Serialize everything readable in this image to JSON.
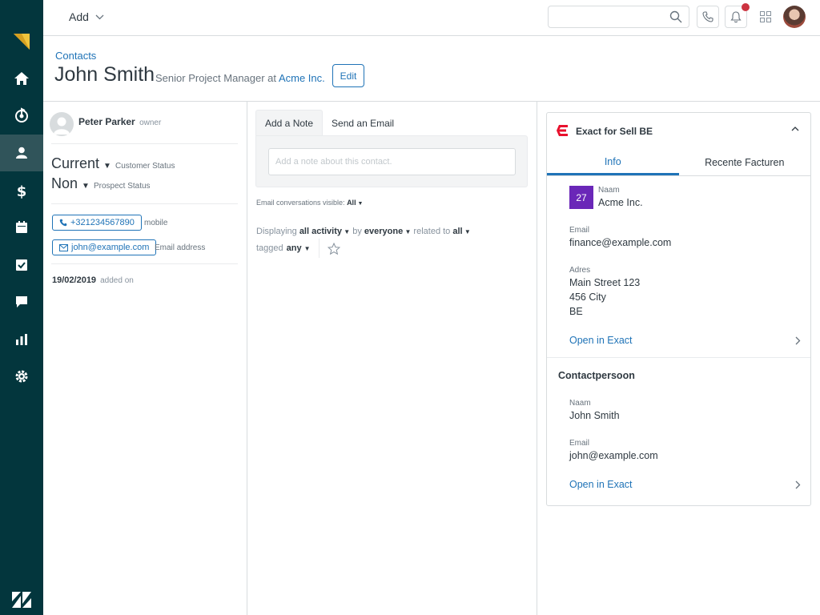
{
  "sidebar": {
    "logo": "zendesk-sell-logo",
    "items": [
      {
        "icon": "home-icon"
      },
      {
        "icon": "leads-icon"
      },
      {
        "icon": "contacts-icon",
        "active": true
      },
      {
        "icon": "deals-icon"
      },
      {
        "icon": "calendar-icon"
      },
      {
        "icon": "tasks-icon"
      },
      {
        "icon": "communication-icon"
      },
      {
        "icon": "reports-icon"
      },
      {
        "icon": "settings-icon"
      }
    ],
    "bottom_logo": "zendesk-logo"
  },
  "topbar": {
    "add_label": "Add",
    "search_value": "",
    "icons": [
      "search-icon",
      "phone-icon",
      "bell-icon",
      "apps-grid-icon",
      "user-avatar"
    ]
  },
  "header": {
    "breadcrumb": "Contacts",
    "name": "John Smith",
    "job_title": "Senior Project Manager at",
    "company": "Acme Inc.",
    "edit_label": "Edit"
  },
  "left": {
    "owner_name": "Peter Parker",
    "owner_role": "owner",
    "customer_status": "Current",
    "customer_status_label": "Customer Status",
    "prospect_status": "Non",
    "prospect_status_label": "Prospect Status",
    "phone": "+321234567890",
    "phone_label": "mobile",
    "email": "john@example.com",
    "email_label": "Email address",
    "added_date": "19/02/2019",
    "added_label": "added on"
  },
  "middle": {
    "tab_note": "Add a Note",
    "tab_email": "Send an Email",
    "note_placeholder": "Add a note about this contact.",
    "email_visible_label": "Email conversations visible:",
    "email_visible_value": "All",
    "f_displaying": "Displaying",
    "f_activity": "all activity",
    "f_by": "by",
    "f_everyone": "everyone",
    "f_related": "related to",
    "f_all": "all",
    "f_tagged": "tagged",
    "f_any": "any"
  },
  "app": {
    "title": "Exact for Sell BE",
    "accent": "#e8112d",
    "tabs": [
      "Info",
      "Recente Facturen"
    ],
    "active_tab": 0,
    "badge": "27",
    "naam_label": "Naam",
    "company_name": "Acme Inc.",
    "email_label": "Email",
    "company_email": "finance@example.com",
    "adres_label": "Adres",
    "adres_line1": "Main Street 123",
    "adres_line2": "456 City",
    "adres_line3": "BE",
    "open_label": "Open in Exact",
    "contact_section": "Contactpersoon",
    "contact_naam_label": "Naam",
    "contact_name": "John Smith",
    "contact_email_label": "Email",
    "contact_email": "john@example.com",
    "open_label_2": "Open in Exact"
  }
}
